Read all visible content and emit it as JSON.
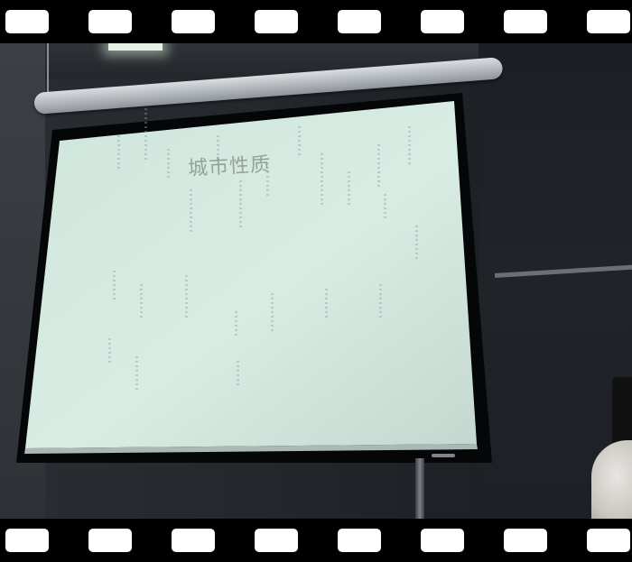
{
  "photo": {
    "kind": "photograph of a projection screen in a dim room, framed with a film-strip border",
    "slide": {
      "title": "城市性质",
      "background_color": "#d8ece3",
      "title_color": "#8a968f"
    },
    "film_strip": {
      "hole_color": "#ffffff",
      "band_color": "#000000"
    }
  }
}
